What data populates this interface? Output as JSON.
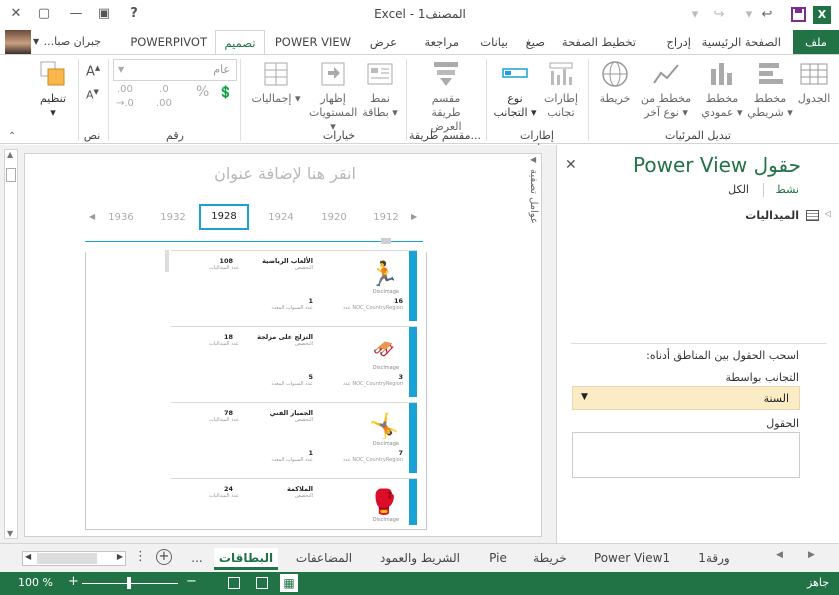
{
  "app": {
    "title": "المصنف1 - Excel",
    "username": "جبران صبا...",
    "help": "?"
  },
  "colors": {
    "accent": "#217346",
    "tile_blue": "#1aa1d6",
    "tile_highlight": "#fcecc5"
  },
  "tabs": [
    "ملف",
    "الصفحة الرئيسية",
    "إدراج",
    "تخطيط الصفحة",
    "صيغ",
    "بيانات",
    "مراجعة",
    "عرض",
    "POWER VIEW",
    "تصميم",
    "POWERPIVOT"
  ],
  "active_tab": "تصميم",
  "ribbon": {
    "buttons": {
      "table": "الجدول",
      "bar_1": "مخطط",
      "bar_2": "شريطي",
      "column_1": "مخطط",
      "column_2": "عمودي",
      "other_1": "مخطط من",
      "other_2": "نوع آخر",
      "map": "خريطة",
      "tiles_by_1": "إطارات",
      "tiles_by_2": "تجانب",
      "tile_type_1": "نوع",
      "tile_type_2": "التجانب",
      "multiples_1": "مقسم",
      "multiples_2": "طريقة العرض",
      "card_style_1": "نمط",
      "card_style_2": "بطاقة",
      "show_levels_1": "إظهار",
      "show_levels_2": "المستويات",
      "totals": "إجماليات",
      "arrange": "تنظيم"
    },
    "number_format": "عام",
    "groups": {
      "switch": "تبديل المرئيات",
      "tiles": "إطارات تجانب",
      "tile_nav": "التجانب",
      "multiples": "مقسم طريقة...",
      "options": "خيارات",
      "number": "رقم",
      "text": "نص"
    }
  },
  "canvas": {
    "add_title": "انقر هنا لإضافة عنوان",
    "filters_label": "عوامل تصفية",
    "timeline": [
      "1912",
      "1920",
      "1924",
      "1928",
      "1932",
      "1936"
    ],
    "selected_year": "1928",
    "cards": [
      {
        "image_label": "DiscImage",
        "sport": "الألعاب الرياضية",
        "sport_sub": "التخصص",
        "medals": "108",
        "medals_sub": "عدد الميداليات",
        "regions": "16",
        "regions_sub": "NOC_CountryRegion عدد",
        "years": "1",
        "years_sub": "عدد السنوات المعدد",
        "glyph": "runner-pictogram"
      },
      {
        "image_label": "DiscImage",
        "sport": "التزلج على مزلجة",
        "sport_sub": "التخصص",
        "medals": "18",
        "medals_sub": "عدد الميداليات",
        "regions": "3",
        "regions_sub": "NOC_CountryRegion عدد",
        "years": "5",
        "years_sub": "عدد السنوات المعدد",
        "glyph": "bobsleigh-pictogram"
      },
      {
        "image_label": "DiscImage",
        "sport": "الجمباز الفني",
        "sport_sub": "التخصص",
        "medals": "78",
        "medals_sub": "عدد الميداليات",
        "regions": "7",
        "regions_sub": "NOC_CountryRegion عدد",
        "years": "1",
        "years_sub": "عدد السنوات المعدد",
        "glyph": "gymnastics-pictogram"
      },
      {
        "image_label": "DiscImage",
        "sport": "الملاكمة",
        "sport_sub": "التخصص",
        "medals": "24",
        "medals_sub": "عدد الميداليات",
        "glyph": "boxing-pictogram"
      }
    ]
  },
  "panel": {
    "title": "حقول Power View",
    "tab_active": "نشط",
    "tab_all": "الكل",
    "table": "الميداليات",
    "drag_hint": "اسحب الحقول بين المناطق أدناه:",
    "tile_by_label": "التجانب بواسطة",
    "tile_by_value": "السنة",
    "fields_label": "الحقول"
  },
  "sheets": [
    "...",
    "البطاقات",
    "المضاعفات",
    "الشريط والعمود",
    "Pie",
    "خريطة",
    "Power View1",
    "ورقة1"
  ],
  "active_sheet": "البطاقات",
  "status": {
    "ready": "جاهز",
    "zoom": "100 %"
  }
}
